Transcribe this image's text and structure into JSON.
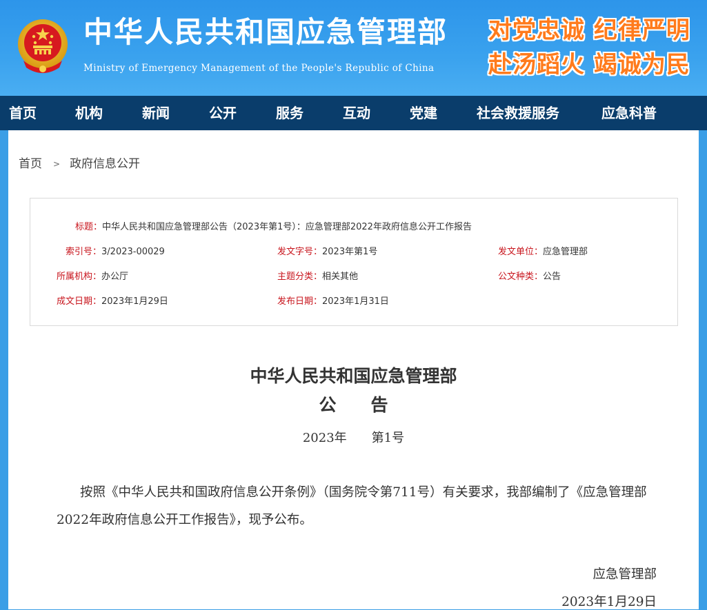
{
  "header": {
    "title": "中华人民共和国应急管理部",
    "subtitle": "Ministry of Emergency Management of the People's Republic of China",
    "slogan_line1": "对党忠诚  纪律严明",
    "slogan_line2": "赴汤蹈火  竭诚为民",
    "emblem_icon": "national-emblem-icon"
  },
  "nav": {
    "items": [
      "首页",
      "机构",
      "新闻",
      "公开",
      "服务",
      "互动",
      "党建",
      "社会救援服务",
      "应急科普"
    ]
  },
  "breadcrumb": {
    "home": "首页",
    "separator": ">",
    "current": "政府信息公开"
  },
  "info": {
    "title_label": "标题：",
    "title_value": "中华人民共和国应急管理部公告（2023年第1号）：应急管理部2022年政府信息公开工作报告",
    "index_label": "索引号：",
    "index_value": "3/2023-00029",
    "doc_no_label": "发文字号：",
    "doc_no_value": "2023年第1号",
    "issuer_label": "发文单位：",
    "issuer_value": "应急管理部",
    "org_label": "所属机构：",
    "org_value": "办公厅",
    "topic_label": "主题分类：",
    "topic_value": "相关其他",
    "type_label": "公文种类：",
    "type_value": "公告",
    "created_label": "成文日期：",
    "created_value": "2023年1月29日",
    "published_label": "发布日期：",
    "published_value": "2023年1月31日"
  },
  "document": {
    "title_line1": "中华人民共和国应急管理部",
    "title_line2": "公　　告",
    "number": "2023年　　第1号",
    "body": "按照《中华人民共和国政府信息公开条例》（国务院令第711号）有关要求，我部编制了《应急管理部2022年政府信息公开工作报告》，现予公布。",
    "signature": "应急管理部",
    "date": "2023年1月29日"
  },
  "colors": {
    "header_blue": "#2d95ea",
    "nav_dark": "#0a3d6b",
    "slogan_orange": "#ff7b1c",
    "label_red": "#c8151d"
  }
}
